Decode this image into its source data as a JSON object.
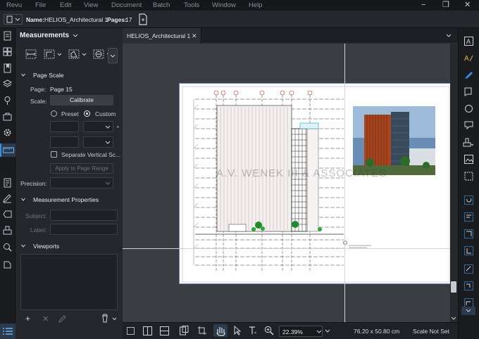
{
  "menu": [
    "Revu",
    "File",
    "Edit",
    "View",
    "Document",
    "Batch",
    "Tools",
    "Window",
    "Help"
  ],
  "window_controls": {
    "minimize": "−",
    "restore": "❐",
    "close": "✕"
  },
  "docbar": {
    "name_label": "Name:",
    "name_value": "HELIOS_Architectural 1",
    "pages_label": "Pages:",
    "pages_value": "17"
  },
  "panel": {
    "title": "Measurements",
    "page_scale": "Page Scale",
    "page_label": "Page:",
    "page_value": "Page 15",
    "scale_label": "Scale:",
    "calibrate": "Calibrate",
    "preset": "Preset",
    "custom": "Custom",
    "separate_vertical": "Separate Vertical Sc...",
    "apply_range": "Apply to Page Range",
    "precision_label": "Precision:",
    "measurement_properties": "Measurement Properties",
    "subject_label": "Subject:",
    "label_label": "Label:",
    "viewports": "Viewports"
  },
  "tab": {
    "title": "HELIOS_Architectural 1",
    "close": "✕"
  },
  "watermark": "A.V. WENEK  III & ASSOCIATES",
  "statusbar": {
    "zoom": "22.39%",
    "dimensions": "76.20 x 50.80 cm",
    "scale": "Scale Not Set"
  },
  "colors": {
    "accent": "#3a8fd9",
    "panel": "#24272c",
    "canvas": "#3a3d42",
    "selected_tool": "#3a8fd9"
  }
}
